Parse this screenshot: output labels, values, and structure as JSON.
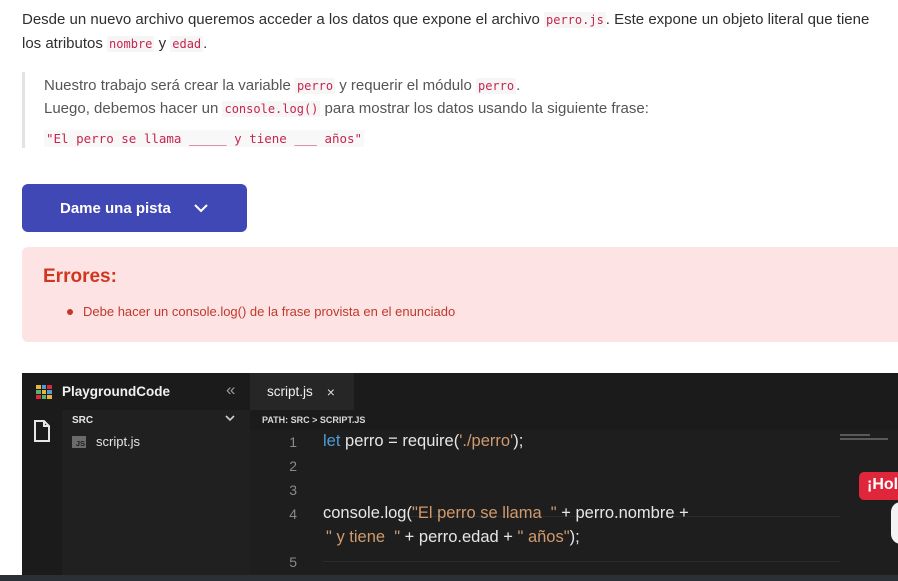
{
  "intro": {
    "t1": "Desde un nuevo archivo queremos acceder a los datos que expone el archivo ",
    "file": "perro.js",
    "t2": ". Este expone un objeto literal que tiene los atributos ",
    "attr1": "nombre",
    "t3": " y ",
    "attr2": "edad",
    "t4": "."
  },
  "quote": {
    "l1a": "Nuestro trabajo será crear la variable ",
    "l1var": "perro",
    "l1b": " y requerir el módulo ",
    "l1mod": "perro",
    "l1c": ".",
    "l2a": "Luego, debemos hacer un ",
    "l2code": "console.log()",
    "l2b": " para mostrar los datos usando la siguiente frase:",
    "phrase": "\"El perro se llama _____ y tiene ___ años\""
  },
  "hint_button": {
    "label": "Dame una pista"
  },
  "errors": {
    "title": "Errores:",
    "items": [
      "Debe hacer un console.log() de la frase provista en el enunciado"
    ]
  },
  "editor": {
    "brand": "PlaygroundCode",
    "collapse_glyph": "«",
    "tab": {
      "label": "script.js",
      "close": "×"
    },
    "explorer": {
      "folder": "SRC",
      "file_badge": "JS",
      "file": "script.js"
    },
    "path": "PATH: SRC > SCRIPT.JS",
    "lines": {
      "n1": "1",
      "n2": "2",
      "n3": "3",
      "n4": "4",
      "n5": "5",
      "l1_kw": "let",
      "l1_a": " perro = require(",
      "l1_str": "'./perro'",
      "l1_b": ");",
      "l4_a": "console.log(",
      "l4_str": "\"El perro se llama  \"",
      "l4_b": " + perro.nombre +",
      "l4w_str1": "\" y tiene  \"",
      "l4w_a": " + perro.edad + ",
      "l4w_str2": "\" años\"",
      "l4w_b": ");"
    }
  },
  "overlay": {
    "greeting": "¡Hola"
  },
  "colors": {
    "accent": "#3f48b5",
    "error_bg": "#fde3e3",
    "error_text": "#d0371f",
    "editor_bg": "#1e1e1e",
    "keyword": "#4f9cd6",
    "string": "#d09a6d",
    "greeting_bg": "#e0263a"
  }
}
